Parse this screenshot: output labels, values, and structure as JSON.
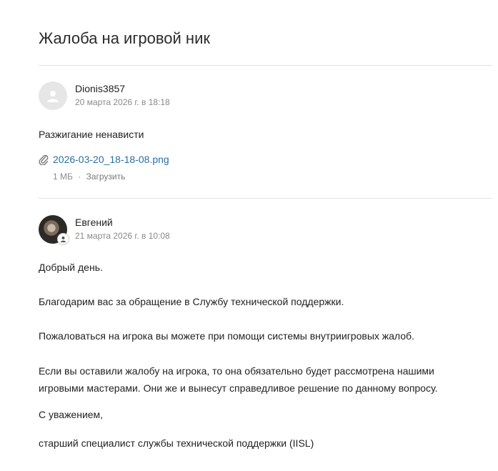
{
  "page": {
    "title": "Жалоба на игровой ник"
  },
  "messages": [
    {
      "author": "Dionis3857",
      "date": "20 марта 2026 г. в 18:18",
      "text": "Разжигание ненависти",
      "attachment": {
        "name": "2026-03-20_18-18-08.png",
        "size": "1 МБ",
        "separator": "·",
        "download_label": "Загрузить"
      }
    },
    {
      "author": "Евгений",
      "date": "21 марта 2026 г. в 10:08",
      "paragraphs": [
        "Добрый день.",
        "Благодарим вас за обращение в Службу технической поддержки.",
        "Пожаловаться на игрока вы можете при помощи системы внутриигровых жалоб.",
        "Если вы оставили жалобу на игрока, то она обязательно будет рассмотрена нашими игровыми мастерами. Они же и вынесут справедливое решение по данному вопросу.",
        "С уважением,",
        "старший специалист службы технической поддержки (IISL)"
      ]
    }
  ],
  "icons": {
    "attachment": "paperclip-icon",
    "default_avatar": "user-icon",
    "agent_badge": "user-badge-icon"
  }
}
